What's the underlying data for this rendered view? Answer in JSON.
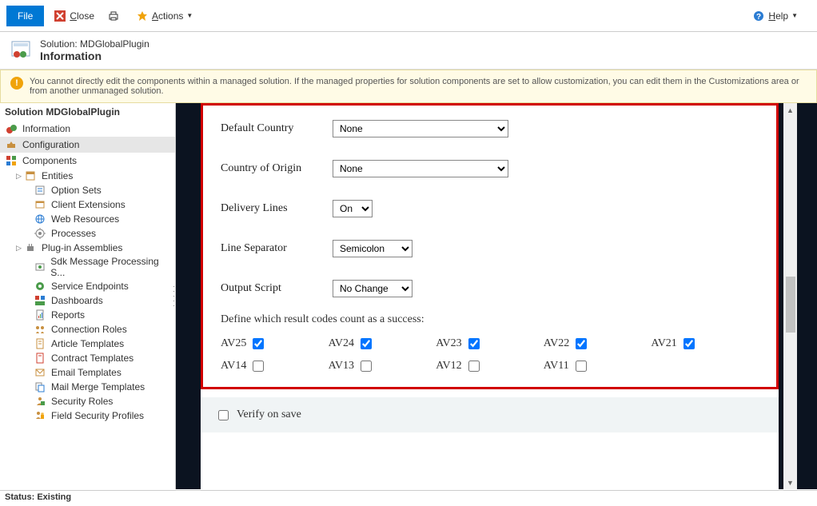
{
  "toolbar": {
    "file": "File",
    "close": "Close",
    "actions": "Actions",
    "help": "Help"
  },
  "header": {
    "line1": "Solution: MDGlobalPlugin",
    "line2": "Information"
  },
  "warning": "You cannot directly edit the components within a managed solution. If the managed properties for solution components are set to allow customization, you can edit them in the Customizations area or from another unmanaged solution.",
  "sidebar": {
    "title": "Solution MDGlobalPlugin",
    "information": "Information",
    "configuration": "Configuration",
    "components": "Components",
    "tree": {
      "entities": "Entities",
      "option_sets": "Option Sets",
      "client_extensions": "Client Extensions",
      "web_resources": "Web Resources",
      "processes": "Processes",
      "plugin_assemblies": "Plug-in Assemblies",
      "sdk_message": "Sdk Message Processing S...",
      "service_endpoints": "Service Endpoints",
      "dashboards": "Dashboards",
      "reports": "Reports",
      "connection_roles": "Connection Roles",
      "article_templates": "Article Templates",
      "contract_templates": "Contract Templates",
      "email_templates": "Email Templates",
      "mail_merge": "Mail Merge Templates",
      "security_roles": "Security Roles",
      "field_security": "Field Security Profiles"
    }
  },
  "form": {
    "default_country_label": "Default Country",
    "default_country_value": "None",
    "country_origin_label": "Country of Origin",
    "country_origin_value": "None",
    "delivery_lines_label": "Delivery Lines",
    "delivery_lines_value": "On",
    "line_separator_label": "Line Separator",
    "line_separator_value": "Semicolon",
    "output_script_label": "Output Script",
    "output_script_value": "No Change",
    "codes_title": "Define which result codes count as a success:",
    "codes": [
      {
        "label": "AV25",
        "checked": true
      },
      {
        "label": "AV24",
        "checked": true
      },
      {
        "label": "AV23",
        "checked": true
      },
      {
        "label": "AV22",
        "checked": true
      },
      {
        "label": "AV21",
        "checked": true
      },
      {
        "label": "AV14",
        "checked": false
      },
      {
        "label": "AV13",
        "checked": false
      },
      {
        "label": "AV12",
        "checked": false
      },
      {
        "label": "AV11",
        "checked": false
      }
    ],
    "verify_label": "Verify on save"
  },
  "status": "Status: Existing"
}
